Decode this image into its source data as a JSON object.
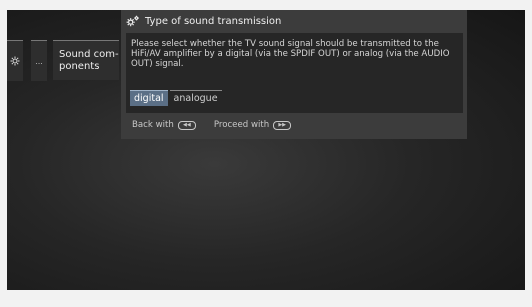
{
  "breadcrumbs": {
    "gear_icon": "gear-icon",
    "ellipsis": "...",
    "sound_components": "Sound com-\nponents"
  },
  "dialog": {
    "title": "Type of sound transmission",
    "icon": "gears-icon",
    "message": "Please select whether the TV sound signal should be transmitted to the HiFi/AV amplifier by a digital (via the SPDIF OUT) or analog (via the AUDIO OUT) signal.",
    "options": [
      {
        "label": "digital",
        "selected": true
      },
      {
        "label": "analogue",
        "selected": false
      }
    ]
  },
  "footer": {
    "back_label": "Back with",
    "back_key_icon": "rewind-key-icon",
    "proceed_label": "Proceed with",
    "proceed_key_icon": "forward-key-icon"
  }
}
